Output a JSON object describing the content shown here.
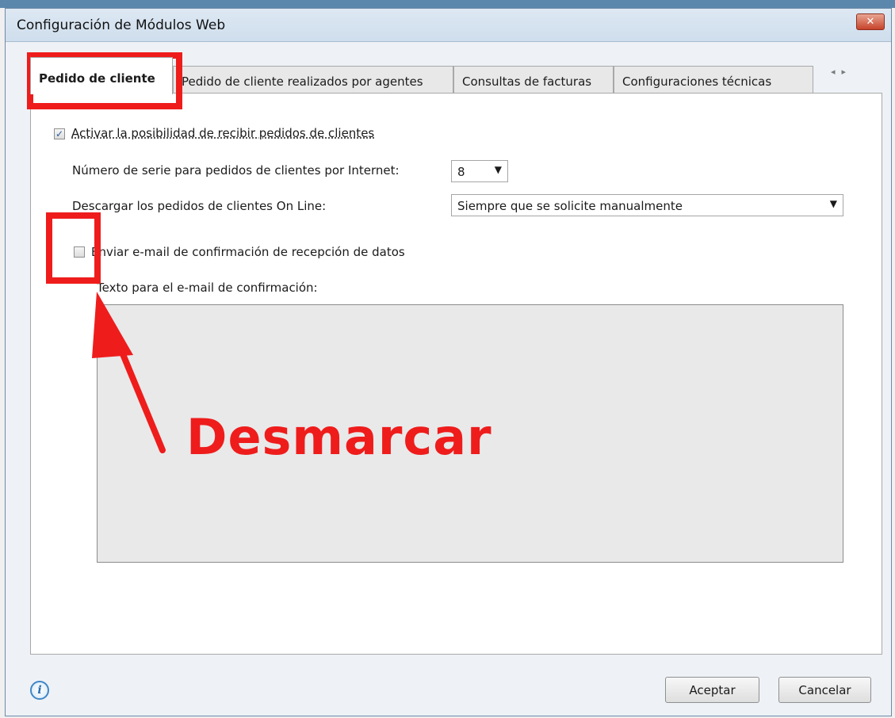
{
  "window": {
    "title": "Configuración de Módulos Web",
    "close_label": "✕"
  },
  "tabs": [
    {
      "label": "Pedido de cliente",
      "active": true
    },
    {
      "label": "Pedido de cliente realizados por agentes",
      "active": false
    },
    {
      "label": "Consultas de facturas",
      "active": false
    },
    {
      "label": "Configuraciones técnicas",
      "active": false
    }
  ],
  "tab_scroll": {
    "left_icon": "◂",
    "right_icon": "▸"
  },
  "form": {
    "activate": {
      "label": "Activar la posibilidad de recibir pedidos de clientes",
      "checked": true
    },
    "serie": {
      "label": "Número de serie para pedidos de clientes por Internet:",
      "value": "8"
    },
    "download": {
      "label": "Descargar los pedidos de clientes On Line:",
      "value": "Siempre que se solicite manualmente"
    },
    "send_email": {
      "label": "Enviar e-mail de confirmación de recepción de datos",
      "checked": false
    },
    "email_text": {
      "label": "Texto para el e-mail de confirmación:",
      "value": ""
    }
  },
  "buttons": {
    "ok": "Aceptar",
    "cancel": "Cancelar"
  },
  "info_icon": "i",
  "annotation": {
    "text": "Desmarcar",
    "color": "#ef1c1c"
  }
}
